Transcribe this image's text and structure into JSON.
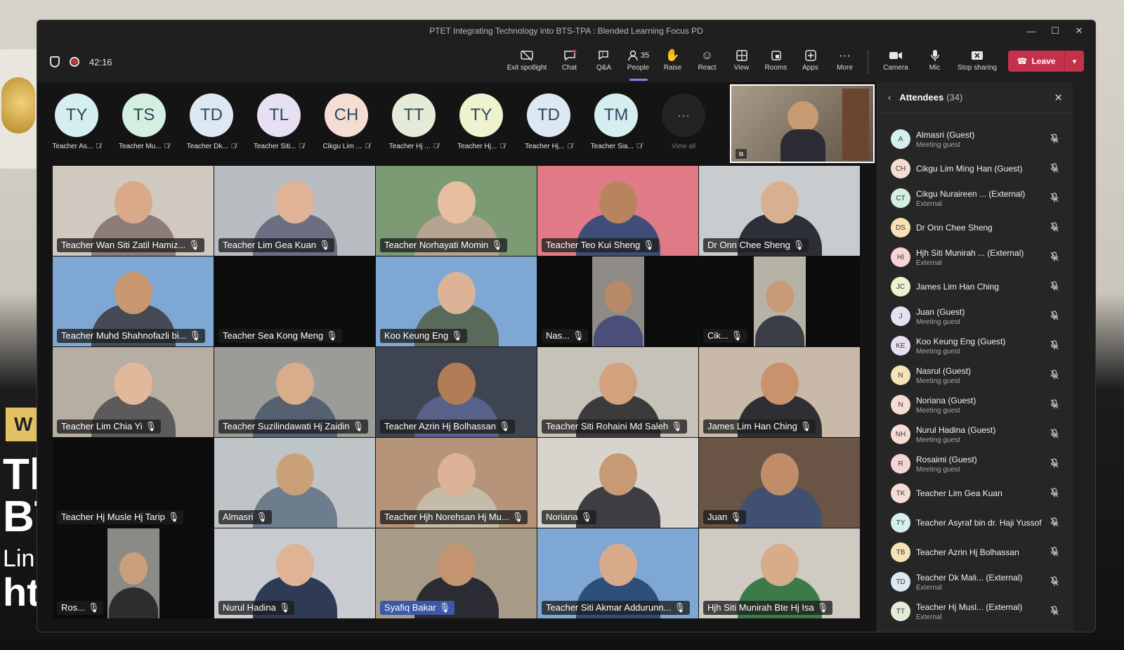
{
  "window": {
    "title": "PTET Integrating Technology into BTS-TPA : Blended Learning Focus PD",
    "controls": [
      "—",
      "☐",
      "✕"
    ]
  },
  "meeting": {
    "timer": "42:16"
  },
  "toolbar": {
    "exit_spotlight": "Exit spotlight",
    "chat": "Chat",
    "qa": "Q&A",
    "people": "People",
    "people_count": "35",
    "raise": "Raise",
    "react": "React",
    "view": "View",
    "rooms": "Rooms",
    "apps": "Apps",
    "more": "More",
    "camera": "Camera",
    "mic": "Mic",
    "stop_sharing": "Stop sharing",
    "leave": "Leave"
  },
  "strip": [
    {
      "initials": "TY",
      "name": "Teacher As...",
      "color": "#d5eef0"
    },
    {
      "initials": "TS",
      "name": "Teacher Mu...",
      "color": "#d3efe0"
    },
    {
      "initials": "TD",
      "name": "Teacher Dk...",
      "color": "#dde8f2"
    },
    {
      "initials": "TL",
      "name": "Teacher Siti...",
      "color": "#e6e0f2"
    },
    {
      "initials": "CH",
      "name": "Cikgu Lim ...",
      "color": "#f6ddd4"
    },
    {
      "initials": "TT",
      "name": "Teacher Hj ...",
      "color": "#e4ecd8"
    },
    {
      "initials": "TY",
      "name": "Teacher Hj...",
      "color": "#eef2cf"
    },
    {
      "initials": "TD",
      "name": "Teacher Hj...",
      "color": "#dde8f2"
    },
    {
      "initials": "TM",
      "name": "Teacher Sia...",
      "color": "#d5eef0"
    }
  ],
  "view_all": {
    "glyph": "···",
    "label": "View all"
  },
  "tiles": [
    {
      "label": "Teacher Wan Siti Zatil Hamiz...",
      "bg": "#cfc9c0",
      "skin": "#d9a98a",
      "shirt": "#8c7c7a"
    },
    {
      "label": "Teacher  Lim Gea Kuan",
      "bg": "#b9bdc2",
      "skin": "#e0b396",
      "shirt": "#6b6f83"
    },
    {
      "label": "Teacher Norhayati Momin",
      "bg": "#7c9a74",
      "skin": "#e5bf9f",
      "shirt": "#b5a48f"
    },
    {
      "label": "Teacher Teo Kui Sheng",
      "bg": "#e07a86",
      "skin": "#b8845e",
      "shirt": "#3f4e78"
    },
    {
      "label": "Dr Onn Chee Sheng",
      "bg": "#c8ccce",
      "skin": "#d8b091",
      "shirt": "#2d2f36"
    },
    {
      "label": "Teacher Muhd Shahnofazli bi...",
      "bg": "#7fa7d3",
      "skin": "#c99770",
      "shirt": "#464a55"
    },
    {
      "label": "Teacher Sea Kong Meng",
      "bg": "#0c0c0c",
      "skin": "",
      "shirt": ""
    },
    {
      "label": "Koo Keung Eng",
      "bg": "#7fa7d3",
      "skin": "#dbb397",
      "shirt": "#5a6a5a"
    },
    {
      "label": "Nas...",
      "bg": "#0c0c0c",
      "skin": "#b88a67",
      "shirt": "#4a4f7a",
      "narrow": "#8e8b86"
    },
    {
      "label": "Cik...",
      "bg": "#0c0c0c",
      "skin": "#c79b79",
      "shirt": "#3a3d45",
      "narrow": "#b7b2a6"
    },
    {
      "label": "Teacher Lim Chia Yi",
      "bg": "#b7aea3",
      "skin": "#e2b89a",
      "shirt": "#5c5a5a"
    },
    {
      "label": "Teacher Suzilindawati Hj Zaidin",
      "bg": "#9b9c98",
      "skin": "#d8ad8c",
      "shirt": "#556071"
    },
    {
      "label": "Teacher Azrin Hj Bolhassan",
      "bg": "#3e4450",
      "skin": "#b07d57",
      "shirt": "#58618a"
    },
    {
      "label": "Teacher Siti Rohaini  Md Saleh",
      "bg": "#c7c2b8",
      "skin": "#d2a27d",
      "shirt": "#3b3b3b"
    },
    {
      "label": "James Lim Han Ching",
      "bg": "#c9b9a8",
      "skin": "#c8926c",
      "shirt": "#2f2f33"
    },
    {
      "label": "Teacher Hj Musle Hj Tarip",
      "bg": "#0c0c0c",
      "skin": "",
      "shirt": ""
    },
    {
      "label": "Almasri",
      "bg": "#bfc4c7",
      "skin": "#caa079",
      "shirt": "#6d7d8e"
    },
    {
      "label": "Teacher Hjh Norehsan Hj Mu...",
      "bg": "#b59479",
      "skin": "#dcb396",
      "shirt": "#c4bba8"
    },
    {
      "label": "Noriana",
      "bg": "#d7d4cd",
      "skin": "#c79a75",
      "shirt": "#3e3e42"
    },
    {
      "label": "Juan",
      "bg": "#6a5446",
      "skin": "#c08d68",
      "shirt": "#3f5070"
    },
    {
      "label": "Ros...",
      "bg": "#0c0c0c",
      "skin": "#caa07a",
      "shirt": "#2d2d2d",
      "narrow": "#8a8a86"
    },
    {
      "label": "Nurul Hadina",
      "bg": "#c8ccd0",
      "skin": "#dfb393",
      "shirt": "#2f3a55"
    },
    {
      "label": "Syafiq Bakar",
      "bg": "#a79a86",
      "skin": "#c49470",
      "shirt": "#2b2b34",
      "highlight": true
    },
    {
      "label": "Teacher Siti Akmar Addurunn...",
      "bg": "#7fa7d3",
      "skin": "#d7ab8a",
      "shirt": "#2e4f7a"
    },
    {
      "label": "Hjh Siti Munirah Bte Hj Isa",
      "bg": "#cfcac2",
      "skin": "#d8ab89",
      "shirt": "#3d7a4a"
    }
  ],
  "attendees": {
    "title": "Attendees",
    "count": "(34)",
    "items": [
      {
        "initials": "A",
        "name": "Almasri (Guest)",
        "sub": "Meeting guest",
        "color": "#d5eef0"
      },
      {
        "initials": "CH",
        "name": "Cikgu Lim Ming Han (Guest)",
        "sub": "",
        "color": "#f6ddd4"
      },
      {
        "initials": "CT",
        "name": "Cikgu Nuraireen ... (External)",
        "sub": "External",
        "color": "#d3efe0"
      },
      {
        "initials": "DS",
        "name": "Dr Onn Chee Sheng",
        "sub": "",
        "color": "#f6e2b5"
      },
      {
        "initials": "HI",
        "name": "Hjh Siti Munirah ... (External)",
        "sub": "External",
        "color": "#f6d4d4"
      },
      {
        "initials": "JC",
        "name": "James Lim Han Ching",
        "sub": "",
        "color": "#eef2cf"
      },
      {
        "initials": "J",
        "name": "Juan (Guest)",
        "sub": "Meeting guest",
        "color": "#e6e0f2"
      },
      {
        "initials": "KE",
        "name": "Koo Keung Eng (Guest)",
        "sub": "Meeting guest",
        "color": "#e6e0f2"
      },
      {
        "initials": "N",
        "name": "Nasrul (Guest)",
        "sub": "Meeting guest",
        "color": "#f6e2b5"
      },
      {
        "initials": "N",
        "name": "Noriana (Guest)",
        "sub": "Meeting guest",
        "color": "#f6ddd4"
      },
      {
        "initials": "NH",
        "name": "Nurul Hadina (Guest)",
        "sub": "Meeting guest",
        "color": "#f6ddd4"
      },
      {
        "initials": "R",
        "name": "Rosaimi (Guest)",
        "sub": "Meeting guest",
        "color": "#f6d4d4"
      },
      {
        "initials": "TK",
        "name": "Teacher Lim Gea Kuan",
        "sub": "",
        "color": "#f6ddd4"
      },
      {
        "initials": "TY",
        "name": "Teacher Asyraf bin dr. Haji Yussof",
        "sub": "",
        "color": "#d5eef0"
      },
      {
        "initials": "TB",
        "name": "Teacher Azrin Hj Bolhassan",
        "sub": "",
        "color": "#f6e2b5"
      },
      {
        "initials": "TD",
        "name": "Teacher Dk Mali...  (External)",
        "sub": "External",
        "color": "#dde8f2"
      },
      {
        "initials": "TT",
        "name": "Teacher Hj Musl...  (External)",
        "sub": "External",
        "color": "#e4ecd8"
      }
    ]
  },
  "backdrop": {
    "banner": "W",
    "line1": "Tl",
    "line2": "BT",
    "line3": "Lin",
    "line4": "ht"
  }
}
